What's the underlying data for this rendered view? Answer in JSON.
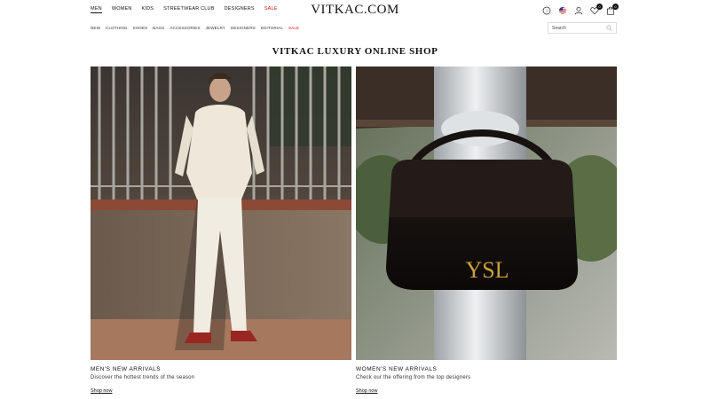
{
  "header": {
    "logo": "VITKAC.COM",
    "top_nav": [
      {
        "label": "MEN",
        "active": true
      },
      {
        "label": "WOMEN"
      },
      {
        "label": "KIDS"
      },
      {
        "label": "STREETWEAR CLUB"
      },
      {
        "label": "DESIGNERS"
      },
      {
        "label": "SALE",
        "sale": true
      }
    ],
    "icons": {
      "help": "help-circle-icon",
      "flag": "us-flag-icon",
      "account": "user-icon",
      "wishlist": "heart-icon",
      "wishlist_count": "0",
      "cart": "shopping-bag-icon",
      "cart_count": "0"
    },
    "sub_nav": [
      {
        "label": "NEW"
      },
      {
        "label": "CLOTHING"
      },
      {
        "label": "SHOES"
      },
      {
        "label": "BAGS"
      },
      {
        "label": "ACCESSORIES"
      },
      {
        "label": "JEWELRY"
      },
      {
        "label": "DESIGNERS"
      },
      {
        "label": "EDITORIAL"
      },
      {
        "label": "SALE",
        "sale": true
      }
    ],
    "search": {
      "placeholder": "Search",
      "icon": "search-icon"
    }
  },
  "main": {
    "title": "VITKAC LUXURY ONLINE SHOP",
    "banners": [
      {
        "title": "MEN'S NEW ARRIVALS",
        "subtitle": "Discover the hottest trends of the season",
        "link": "Shop now"
      },
      {
        "title": "WOMEN'S NEW ARRIVALS",
        "subtitle": "Check our the offering from the top designers",
        "link": "Shop now",
        "bag_monogram": "YSL"
      }
    ]
  },
  "colors": {
    "sale": "#d2141e",
    "text": "#111111"
  }
}
